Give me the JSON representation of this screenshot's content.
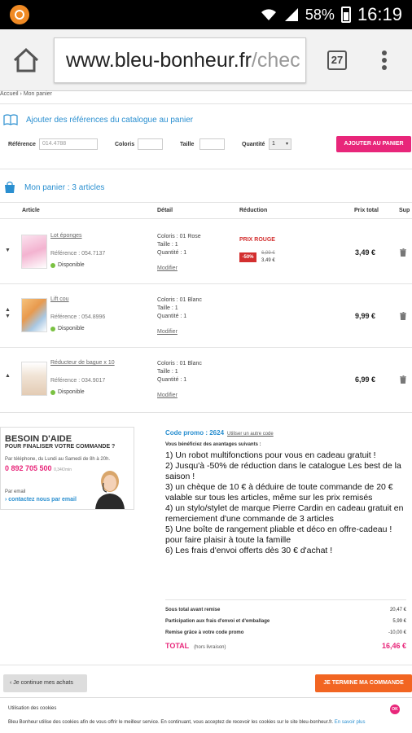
{
  "status_bar": {
    "battery": "58%",
    "time": "16:19"
  },
  "browser": {
    "url_main": "www.bleu-bonheur.fr",
    "url_rest": "/chec",
    "tab_count": "27"
  },
  "breadcrumb": {
    "home": "Accueil",
    "sep": "›",
    "current": "Mon panier"
  },
  "catalog": {
    "title": "Ajouter des références du catalogue au panier",
    "ref_label": "Référence",
    "ref_placeholder": "014.4788",
    "colors_label": "Coloris",
    "size_label": "Taille",
    "qty_label": "Quantité",
    "qty_value": "1",
    "add_button": "AJOUTER AU PANIER"
  },
  "cart": {
    "title": "Mon panier : 3 articles",
    "headers": {
      "article": "Article",
      "detail": "Détail",
      "reduction": "Réduction",
      "total": "Prix total",
      "delete": "Sup"
    },
    "items": [
      {
        "name": "Lot éponges",
        "ref": "Référence : 054.7137",
        "dispo": "Disponible",
        "color": "Coloris : 01 Rose",
        "size": "Taille : 1",
        "qty": "Quantité : 1",
        "modify": "Modifier",
        "promo_label": "PRIX ROUGE",
        "discount": "-50%",
        "old_price": "6,99 €",
        "new_price": "3,49 €",
        "total": "3,49 €"
      },
      {
        "name": "Lift cou",
        "ref": "Référence : 054.8996",
        "dispo": "Disponible",
        "color": "Coloris : 01 Blanc",
        "size": "Taille : 1",
        "qty": "Quantité : 1",
        "modify": "Modifier",
        "total": "9,99 €"
      },
      {
        "name": "Réducteur de bague x 10",
        "ref": "Référence : 034.9017",
        "dispo": "Disponible",
        "color": "Coloris : 01 Blanc",
        "size": "Taille : 1",
        "qty": "Quantité : 1",
        "modify": "Modifier",
        "total": "6,99 €"
      }
    ]
  },
  "help": {
    "title": "BESOIN D'AIDE",
    "subtitle": "POUR FINALISER VOTRE COMMANDE ?",
    "hours": "Par téléphone, du Lundi au Samedi de 8h à 20h.",
    "phone": "0 892 705 500",
    "phone_price": "0,34€/min",
    "email_label": "Par email",
    "contact_link": "› contactez nous par email"
  },
  "promo": {
    "code_label": "Code promo : 2624",
    "other_code": "Utiliser un autre code",
    "intro": "Vous bénéficiez des avantages suivants :",
    "benefits": [
      "1) Un robot multifonctions pour vous en cadeau gratuit !",
      "2) Jusqu'à -50% de réduction dans le catalogue Les best de la saison !",
      "3) un chèque de 10 € à déduire de toute commande de 20 € valable sur tous les articles, même sur les prix remisés",
      "4) un stylo/stylet de marque Pierre Cardin en cadeau gratuit en remerciement d'une commande de 3 articles",
      "5) Une boîte de rangement pliable et déco en offre-cadeau ! pour faire plaisir à toute la famille",
      "6) Les frais d'envoi offerts dès 30 € d'achat !"
    ]
  },
  "summary": {
    "subtotal_label": "Sous total avant remise",
    "subtotal": "20,47 €",
    "shipping_label": "Participation aux frais d'envoi et d'emballage",
    "shipping": "5,99 €",
    "discount_label": "Remise grâce à votre code promo",
    "discount": "-10,00 €",
    "total_label": "TOTAL",
    "total_hint": "(hors livraison)",
    "total": "16,46 €"
  },
  "actions": {
    "continue": "Je continue mes achats",
    "checkout": "JE TERMINE MA COMMANDE"
  },
  "cookies": {
    "title": "Utilisation des cookies",
    "text": "Bleu Bonheur utilise des cookies afin de vous offrir le meilleur service. En continuant, vous acceptez de recevoir les cookies sur le site bleu-bonheur.fr.",
    "link": "En savoir plus",
    "ok": "OK"
  },
  "colors": {
    "pink": "#e8267a",
    "blue": "#2a8fd0",
    "orange": "#f26522",
    "red": "#d32f2f",
    "green": "#7ac142"
  }
}
